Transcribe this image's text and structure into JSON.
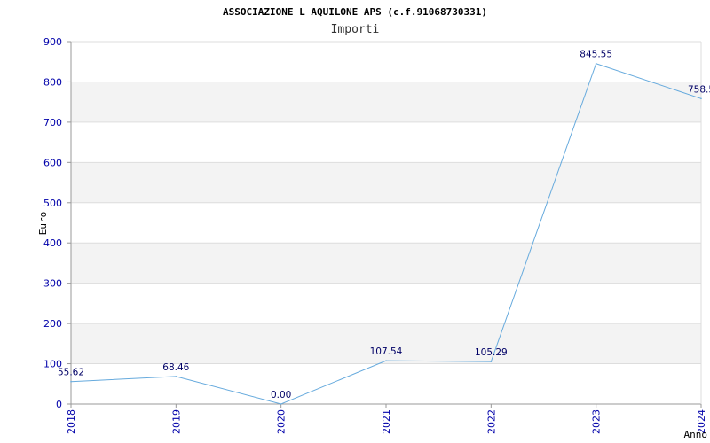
{
  "chart_data": {
    "type": "line",
    "title": "ASSOCIAZIONE L AQUILONE APS (c.f.91068730331)",
    "subtitle": "Importi",
    "xlabel": "Anno",
    "ylabel": "Euro",
    "x": [
      "2018",
      "2019",
      "2020",
      "2021",
      "2022",
      "2023",
      "2024"
    ],
    "series": [
      {
        "values": [
          55.62,
          68.46,
          0.0,
          107.54,
          105.29,
          845.55,
          758.5
        ],
        "labels": [
          "55.62",
          "68.46",
          "0.00",
          "107.54",
          "105.29",
          "845.55",
          "758.5"
        ],
        "color": "#66aadd"
      }
    ],
    "ylim": [
      0,
      900
    ],
    "yticks": [
      0,
      100,
      200,
      300,
      400,
      500,
      600,
      700,
      800,
      900
    ],
    "grid": true,
    "band_color": "#f3f3f3",
    "grid_color": "#dddddd",
    "tick_color": "#0000aa"
  }
}
